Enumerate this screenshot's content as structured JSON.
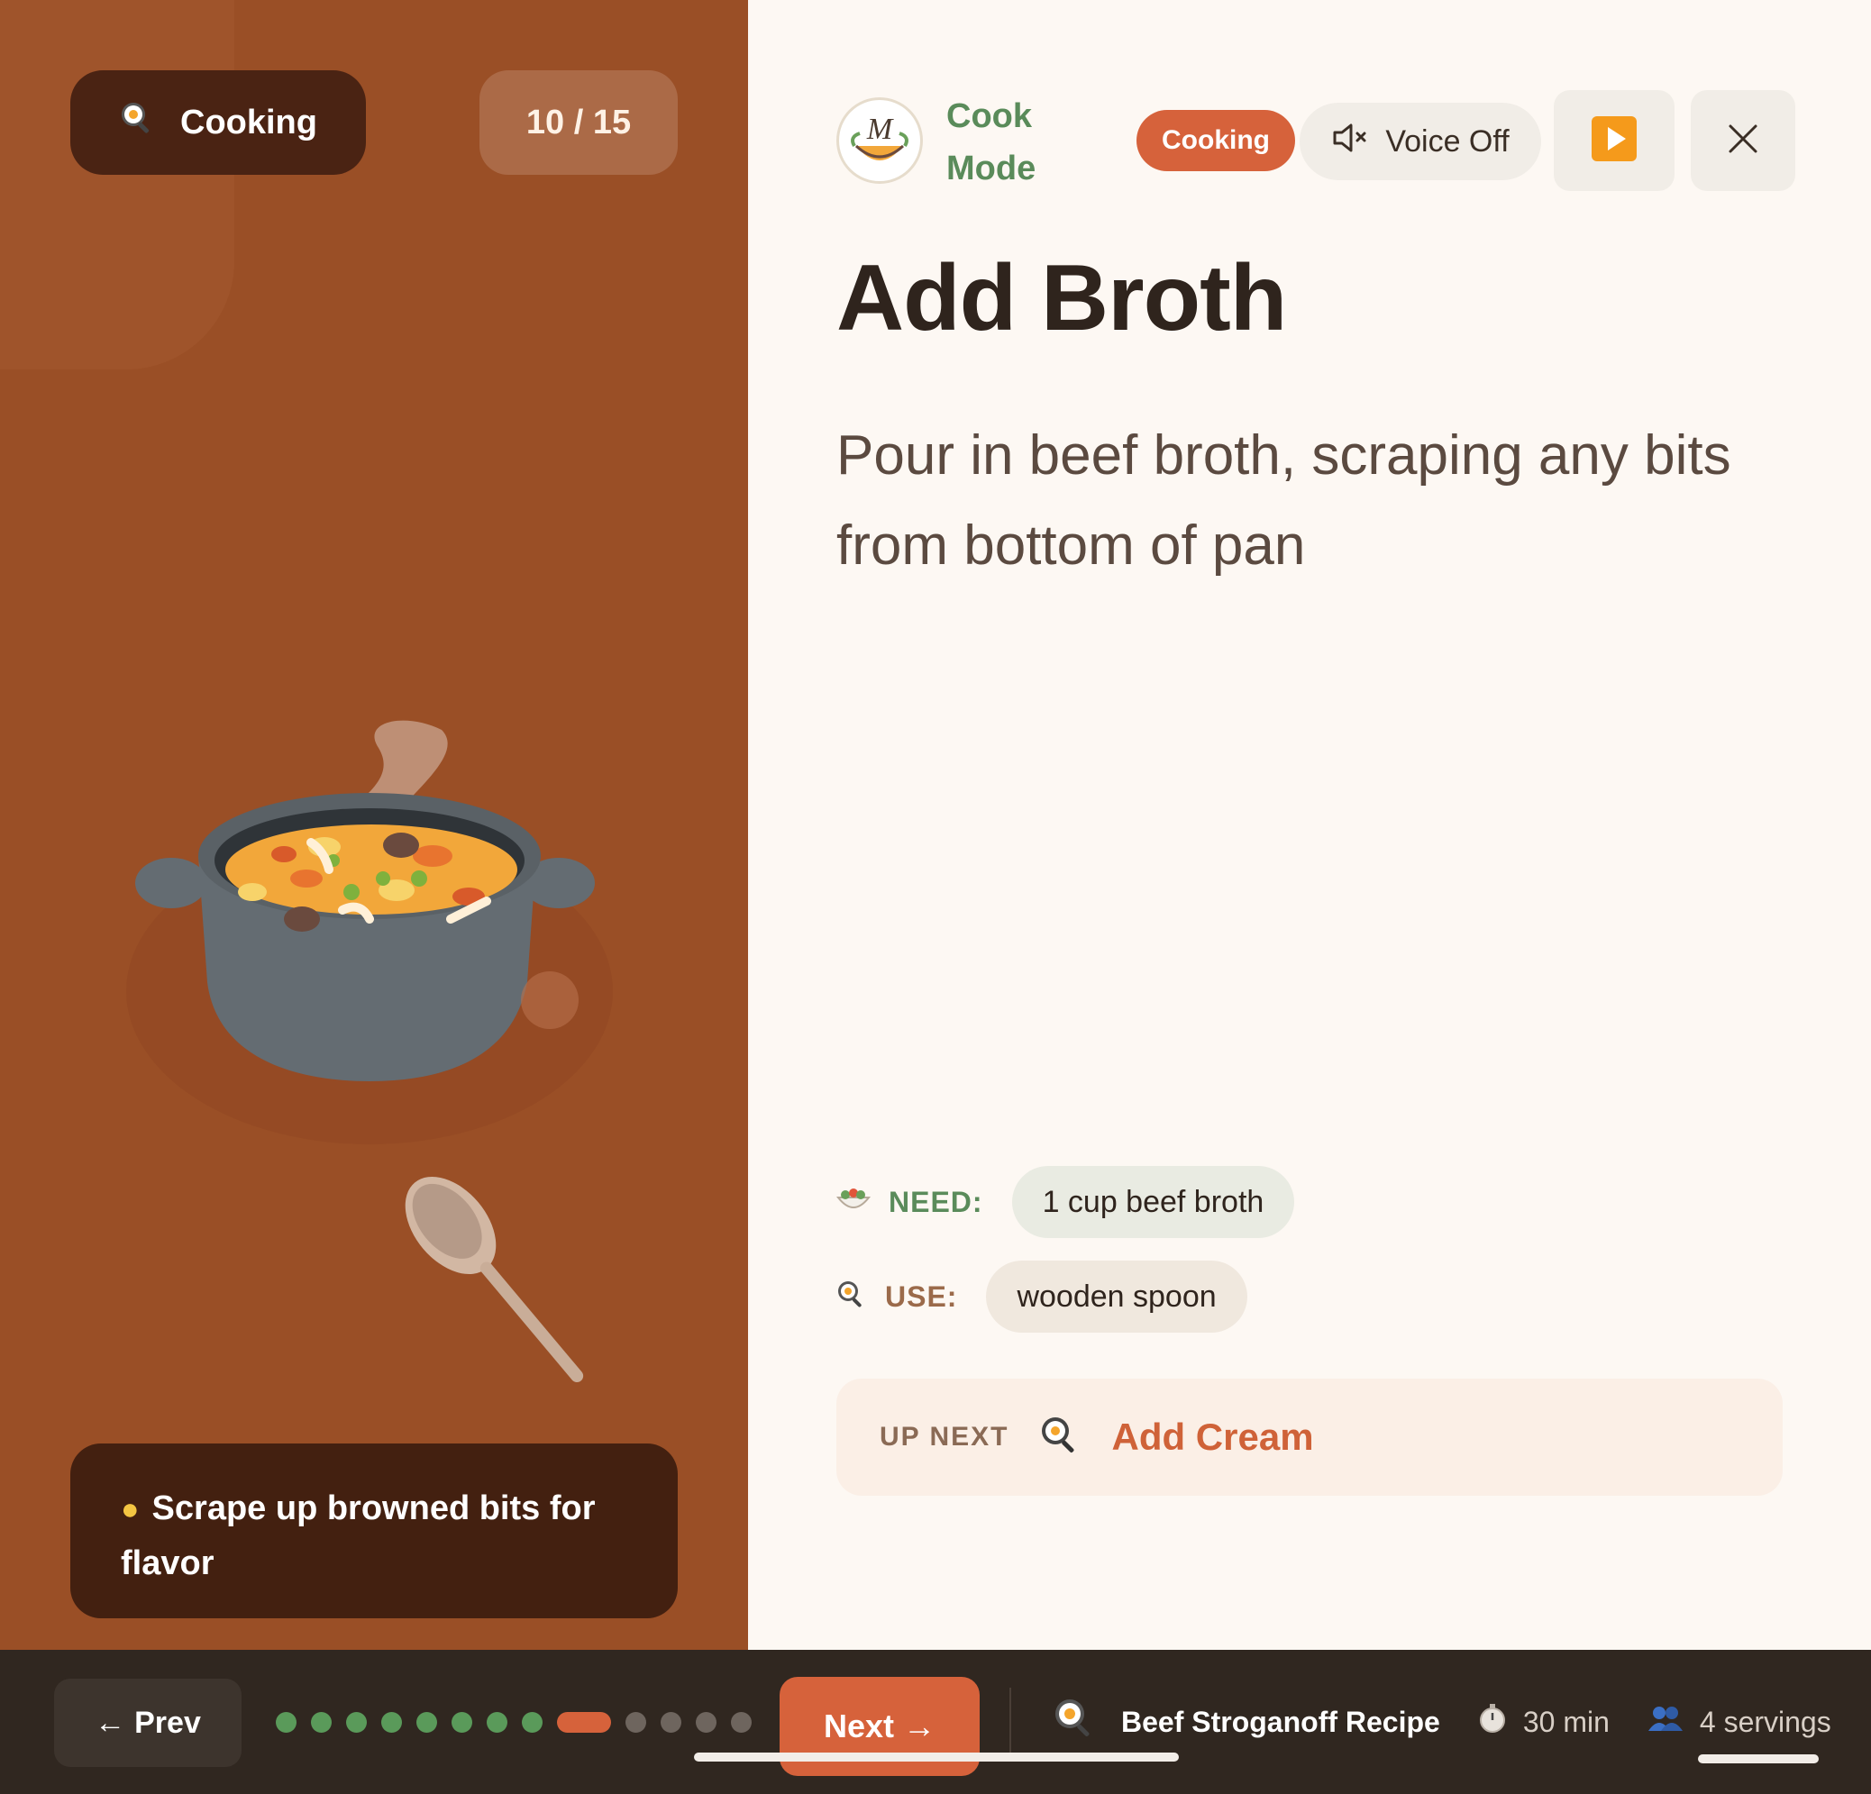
{
  "left": {
    "mode_label": "Cooking",
    "step_counter": "10 / 15",
    "tip_text": "Scrape up browned bits for flavor"
  },
  "header": {
    "brand_line1": "Cook",
    "brand_line2": "Mode",
    "status_badge": "Cooking",
    "voice_label": "Voice Off"
  },
  "step": {
    "title": "Add Broth",
    "description": "Pour in beef broth, scraping any bits from bottom of pan",
    "need_label": "NEED:",
    "need_item": "1 cup beef broth",
    "use_label": "USE:",
    "use_item": "wooden spoon"
  },
  "up_next": {
    "label": "UP NEXT",
    "title": "Add Cream"
  },
  "footer": {
    "prev_label": "Prev",
    "next_label": "Next",
    "recipe_name": "Beef Stroganoff Recipe",
    "time": "30 min",
    "servings": "4 servings",
    "steps_total": 13,
    "current_step_index": 8
  },
  "colors": {
    "accent": "#d6623b",
    "left_panel": "#9a4f26",
    "brand_green": "#5a8b5a",
    "footer_bg": "#302720"
  },
  "icons": {
    "mode": "frying-pan-icon",
    "tip": "light-bulb-icon",
    "voice": "speaker-muted-icon",
    "play": "play-icon",
    "close": "close-icon",
    "need": "salad-icon",
    "use": "frying-pan-icon",
    "time": "stopwatch-icon",
    "servings": "people-icon"
  }
}
